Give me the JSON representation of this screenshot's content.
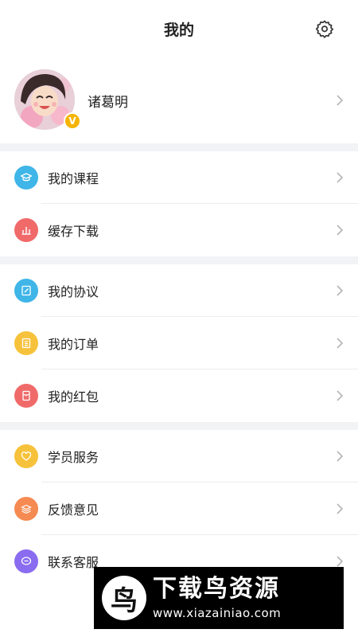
{
  "header": {
    "title": "我的"
  },
  "profile": {
    "name": "诸葛明",
    "badge": "V"
  },
  "groups": [
    {
      "items": [
        {
          "label": "我的课程",
          "color": "#3fb5e8",
          "icon": "graduation-cap-icon"
        },
        {
          "label": "缓存下载",
          "color": "#f06a6a",
          "icon": "download-bars-icon"
        }
      ]
    },
    {
      "items": [
        {
          "label": "我的协议",
          "color": "#3fb5e8",
          "icon": "edit-document-icon"
        },
        {
          "label": "我的订单",
          "color": "#f7c23b",
          "icon": "order-list-icon"
        },
        {
          "label": "我的红包",
          "color": "#f06a6a",
          "icon": "red-envelope-icon"
        }
      ]
    },
    {
      "items": [
        {
          "label": "学员服务",
          "color": "#f7c23b",
          "icon": "heart-icon"
        },
        {
          "label": "反馈意见",
          "color": "#f58a52",
          "icon": "layers-icon"
        },
        {
          "label": "联系客服",
          "color": "#8a6cf0",
          "icon": "chat-bubble-icon"
        }
      ]
    }
  ],
  "watermark": {
    "title": "下载鸟资源",
    "url": "www.xiazainiao.com",
    "logo": "鸟"
  }
}
